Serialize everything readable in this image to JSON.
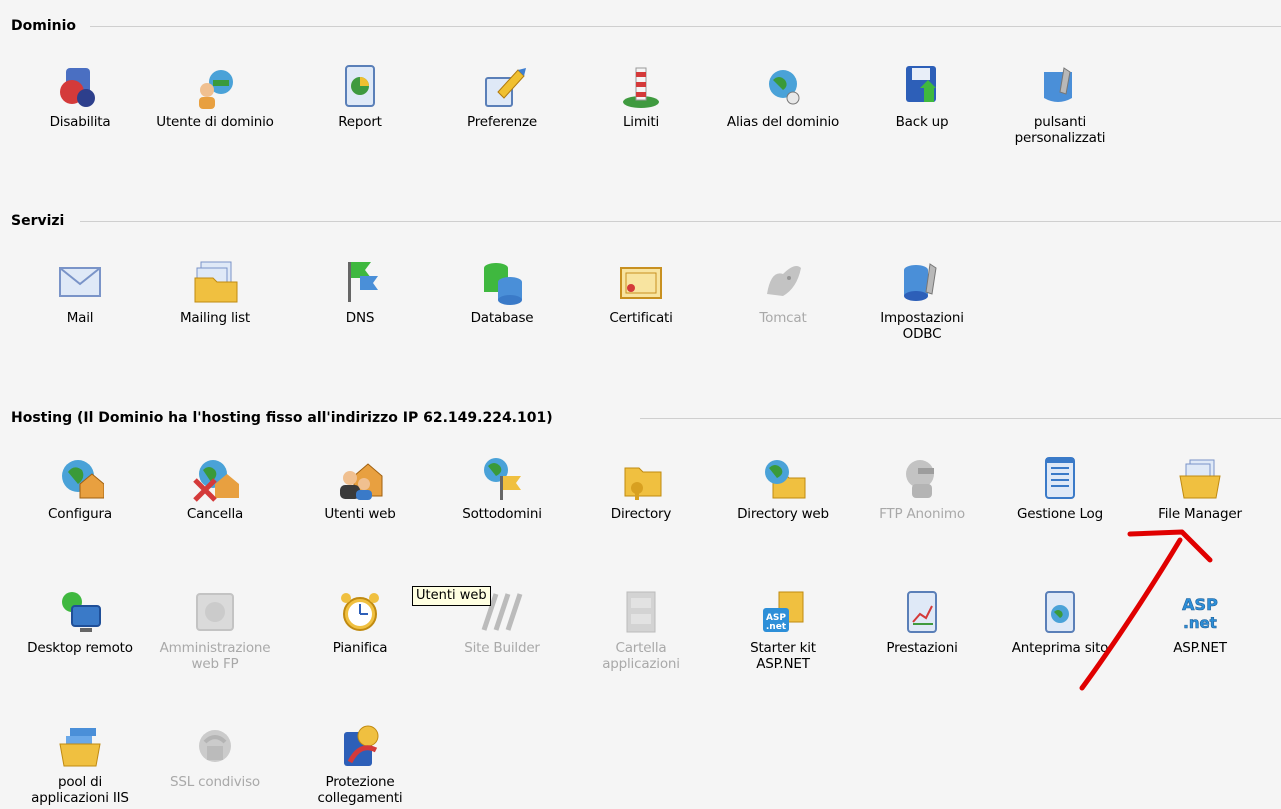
{
  "sections": {
    "dominio": {
      "title": "Dominio",
      "items": [
        {
          "label": "Disabilita",
          "icon": "disable-icon"
        },
        {
          "label": "Utente di dominio",
          "icon": "domain-user-icon"
        },
        {
          "label": "Report",
          "icon": "report-icon"
        },
        {
          "label": "Preferenze",
          "icon": "preferences-icon"
        },
        {
          "label": "Limiti",
          "icon": "limits-icon"
        },
        {
          "label": "Alias del dominio",
          "icon": "domain-alias-icon"
        },
        {
          "label": "Back up",
          "icon": "backup-icon"
        },
        {
          "label": "pulsanti\npersonalizzati",
          "icon": "custom-buttons-icon"
        }
      ]
    },
    "servizi": {
      "title": "Servizi",
      "items": [
        {
          "label": "Mail",
          "icon": "mail-icon"
        },
        {
          "label": "Mailing list",
          "icon": "mailing-list-icon"
        },
        {
          "label": "DNS",
          "icon": "dns-icon"
        },
        {
          "label": "Database",
          "icon": "database-icon"
        },
        {
          "label": "Certificati",
          "icon": "certificate-icon"
        },
        {
          "label": "Tomcat",
          "icon": "tomcat-icon",
          "disabled": true
        },
        {
          "label": "Impostazioni\nODBC",
          "icon": "odbc-icon"
        }
      ]
    },
    "hosting": {
      "title": "Hosting (Il Dominio ha l'hosting fisso all'indirizzo IP 62.149.224.101)",
      "row1": [
        {
          "label": "Configura",
          "icon": "configure-icon"
        },
        {
          "label": "Cancella",
          "icon": "delete-icon"
        },
        {
          "label": "Utenti web",
          "icon": "web-users-icon"
        },
        {
          "label": "Sottodomini",
          "icon": "subdomains-icon"
        },
        {
          "label": "Directory",
          "icon": "directory-icon"
        },
        {
          "label": "Directory web",
          "icon": "web-directory-icon"
        },
        {
          "label": "FTP Anonimo",
          "icon": "anonymous-ftp-icon",
          "disabled": true
        },
        {
          "label": "Gestione Log",
          "icon": "log-management-icon"
        },
        {
          "label": "File Manager",
          "icon": "file-manager-icon"
        }
      ],
      "row2": [
        {
          "label": "Desktop remoto",
          "icon": "remote-desktop-icon"
        },
        {
          "label": "Amministrazione\nweb FP",
          "icon": "frontpage-admin-icon",
          "disabled": true
        },
        {
          "label": "Pianifica",
          "icon": "alarm-clock-icon"
        },
        {
          "label": "Site Builder",
          "icon": "site-builder-icon",
          "disabled": true
        },
        {
          "label": "Cartella\napplicazioni",
          "icon": "application-folder-icon",
          "disabled": true
        },
        {
          "label": "Starter kit\nASP.NET",
          "icon": "starter-kit-icon"
        },
        {
          "label": "Prestazioni",
          "icon": "performance-icon"
        },
        {
          "label": "Anteprima sito",
          "icon": "site-preview-icon"
        },
        {
          "label": "ASP.NET",
          "icon": "aspnet-icon"
        }
      ],
      "row3": [
        {
          "label": "pool di\napplicazioni IIS",
          "icon": "iis-pool-icon"
        },
        {
          "label": "SSL condiviso",
          "icon": "shared-ssl-icon",
          "disabled": true
        },
        {
          "label": "Protezione\ncollegamenti",
          "icon": "link-protection-icon"
        }
      ]
    }
  },
  "tooltip": "Utenti web",
  "annotation_color": "#e00000"
}
